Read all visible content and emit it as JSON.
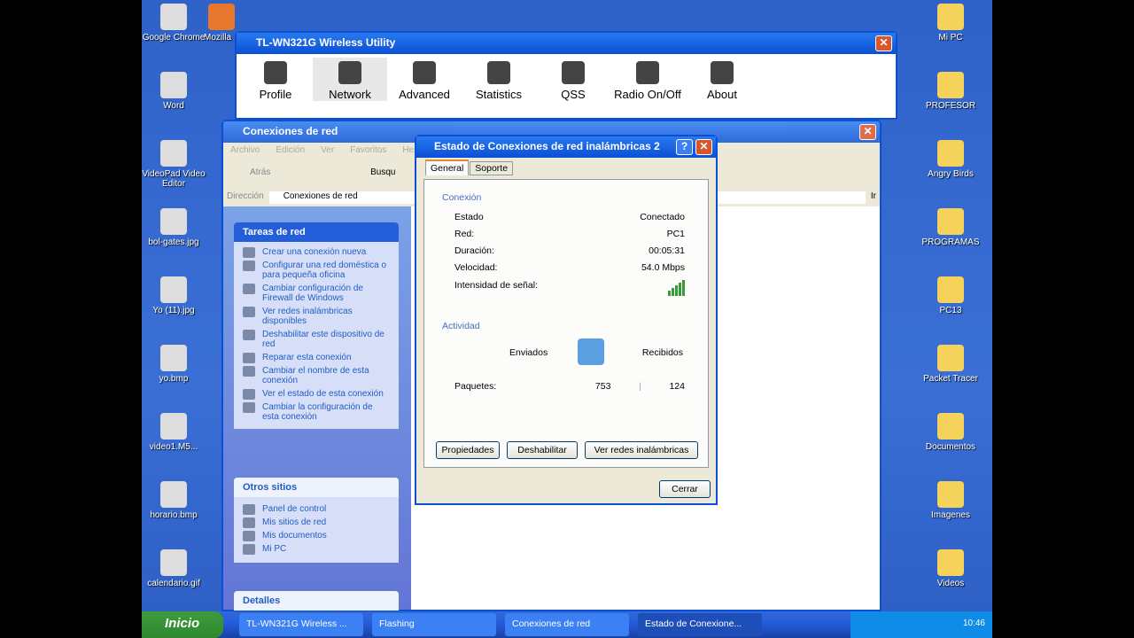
{
  "desktop": {
    "left": [
      "Google Chrome",
      "Word",
      "VideoPad Video Editor",
      "bol-gates.jpg",
      "Yo (11).jpg",
      "yo.bmp",
      "video1.M5...",
      "horario.bmp",
      "calendario.gif"
    ],
    "right": [
      "Mi PC",
      "PROFESOR",
      "Angry Birds",
      "PROGRAMAS",
      "PC13",
      "Packet Tracer",
      "Documentos",
      "Imagenes",
      "Videos"
    ],
    "top2": "Mozilla"
  },
  "utility": {
    "title": "TL-WN321G Wireless Utility",
    "tools": [
      "Profile",
      "Network",
      "Advanced",
      "Statistics",
      "QSS",
      "Radio On/Off",
      "About"
    ]
  },
  "netconn": {
    "title": "Conexiones de red",
    "menu": [
      "Archivo",
      "Edición",
      "Ver",
      "Favoritos",
      "Herramientas"
    ],
    "back": "Atrás",
    "search": "Busqu",
    "address_label": "Dirección",
    "address": "Conexiones de red",
    "go": "Ir",
    "tasks": {
      "title": "Tareas de red",
      "items": [
        "Crear una conexión nueva",
        "Configurar una red doméstica o para pequeña oficina",
        "Cambiar configuración de Firewall de Windows",
        "Ver redes inalámbricas disponibles",
        "Deshabilitar este dispositivo de red",
        "Reparar esta conexión",
        "Cambiar el nombre de esta conexión",
        "Ver el estado de esta conexión",
        "Cambiar la configuración de esta conexión"
      ]
    },
    "other": {
      "title": "Otros sitios",
      "items": [
        "Panel de control",
        "Mis sitios de red",
        "Mis documentos",
        "Mi PC"
      ]
    },
    "details": {
      "title": "Detalles"
    }
  },
  "dialog": {
    "title": "Estado de Conexiones de red inalámbricas 2",
    "tabs": [
      "General",
      "Soporte"
    ],
    "conn_label": "Conexión",
    "rows": [
      [
        "Estado",
        "Conectado"
      ],
      [
        "Red:",
        "PC1"
      ],
      [
        "Duración:",
        "00:05:31"
      ],
      [
        "Velocidad:",
        "54.0 Mbps"
      ]
    ],
    "signal_label": "Intensidad de señal:",
    "activity_label": "Actividad",
    "sent": "Enviados",
    "received": "Recibidos",
    "packets_label": "Paquetes:",
    "packets_sent": "753",
    "packets_received": "124",
    "buttons": [
      "Propiedades",
      "Deshabilitar",
      "Ver redes inalámbricas"
    ],
    "close": "Cerrar"
  },
  "taskbar": {
    "start": "Inicio",
    "items": [
      "TL-WN321G Wireless ...",
      "Flashing",
      "Conexiones de red",
      "Estado de Conexione..."
    ],
    "clock": "10:46"
  }
}
